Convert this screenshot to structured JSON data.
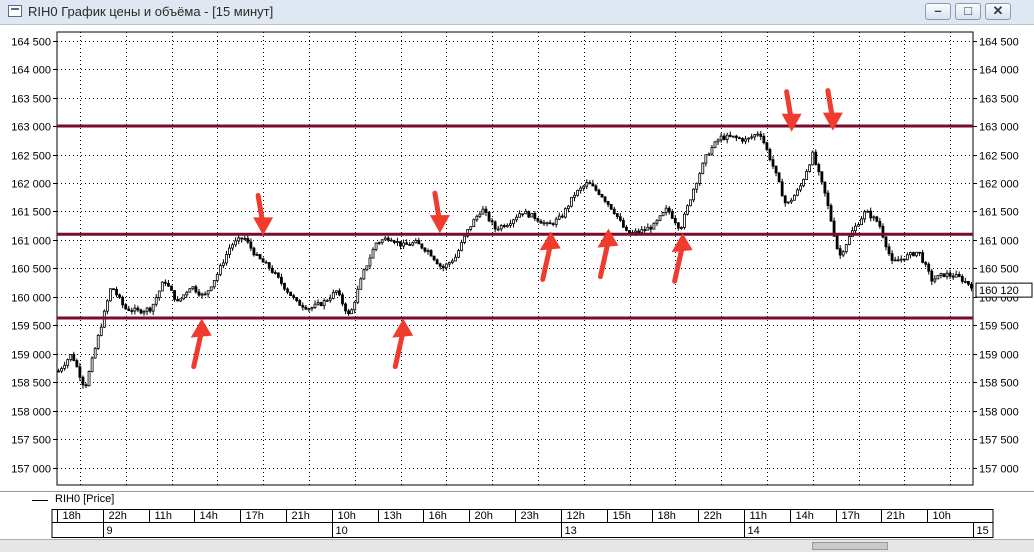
{
  "window": {
    "title": "RIH0 График цены и объёма - [15 минут]",
    "buttons": {
      "minimize_icon": "minimize-icon",
      "maximize_icon": "maximize-icon",
      "close_icon": "close-icon"
    }
  },
  "legend": {
    "label": "RIH0 [Price]"
  },
  "colors": {
    "level_line": "#7a0a2e",
    "arrow": "#f03c2e",
    "candle": "#000000",
    "grid": "#000000"
  },
  "chart_data": {
    "type": "candlestick",
    "title": "",
    "ylabel": "",
    "ylim": [
      156700,
      164650
    ],
    "y_ticks": [
      "164 500",
      "164 000",
      "163 500",
      "163 000",
      "162 500",
      "162 000",
      "161 500",
      "161 000",
      "160 500",
      "160 000",
      "159 500",
      "159 000",
      "158 500",
      "158 000",
      "157 500",
      "157 000"
    ],
    "y_tick_values": [
      164500,
      164000,
      163500,
      163000,
      162500,
      162000,
      161500,
      161000,
      160500,
      160000,
      159500,
      159000,
      158500,
      158000,
      157500,
      157000
    ],
    "x_time_labels": [
      "18h",
      "22h",
      "11h",
      "14h",
      "17h",
      "21h",
      "10h",
      "13h",
      "16h",
      "20h",
      "23h",
      "12h",
      "15h",
      "18h",
      "22h",
      "11h",
      "14h",
      "17h",
      "21h",
      "10h"
    ],
    "x_date_labels": [
      "9",
      "10",
      "13",
      "14",
      "15"
    ],
    "last_price_label": "160 120",
    "horizontal_levels": [
      163000,
      161100,
      159630
    ],
    "price_path": [
      158700,
      159000,
      158400,
      159300,
      160200,
      159800,
      159750,
      159800,
      160300,
      159900,
      160200,
      160000,
      160400,
      160900,
      161050,
      160700,
      160500,
      160200,
      159900,
      159800,
      159900,
      160100,
      159650,
      160400,
      160950,
      161050,
      160900,
      160950,
      160800,
      160500,
      160700,
      161200,
      161550,
      161200,
      161300,
      161500,
      161400,
      161250,
      161400,
      161800,
      162000,
      161800,
      161500,
      161100,
      161150,
      161250,
      161550,
      161200,
      161900,
      162500,
      162800,
      162800,
      162750,
      162900,
      162300,
      161600,
      161900,
      162500,
      161750,
      160700,
      161150,
      161500,
      161300,
      160600,
      160700,
      160800,
      160300,
      160400,
      160350,
      160200
    ],
    "arrows": [
      {
        "direction": "up",
        "price": 159620,
        "pos": 0.158
      },
      {
        "direction": "down",
        "price": 161080,
        "pos": 0.225
      },
      {
        "direction": "up",
        "price": 159620,
        "pos": 0.378
      },
      {
        "direction": "down",
        "price": 161120,
        "pos": 0.418
      },
      {
        "direction": "up",
        "price": 161150,
        "pos": 0.539
      },
      {
        "direction": "up",
        "price": 161200,
        "pos": 0.602
      },
      {
        "direction": "up",
        "price": 161120,
        "pos": 0.683
      },
      {
        "direction": "down",
        "price": 162900,
        "pos": 0.802
      },
      {
        "direction": "down",
        "price": 162920,
        "pos": 0.847
      }
    ]
  }
}
